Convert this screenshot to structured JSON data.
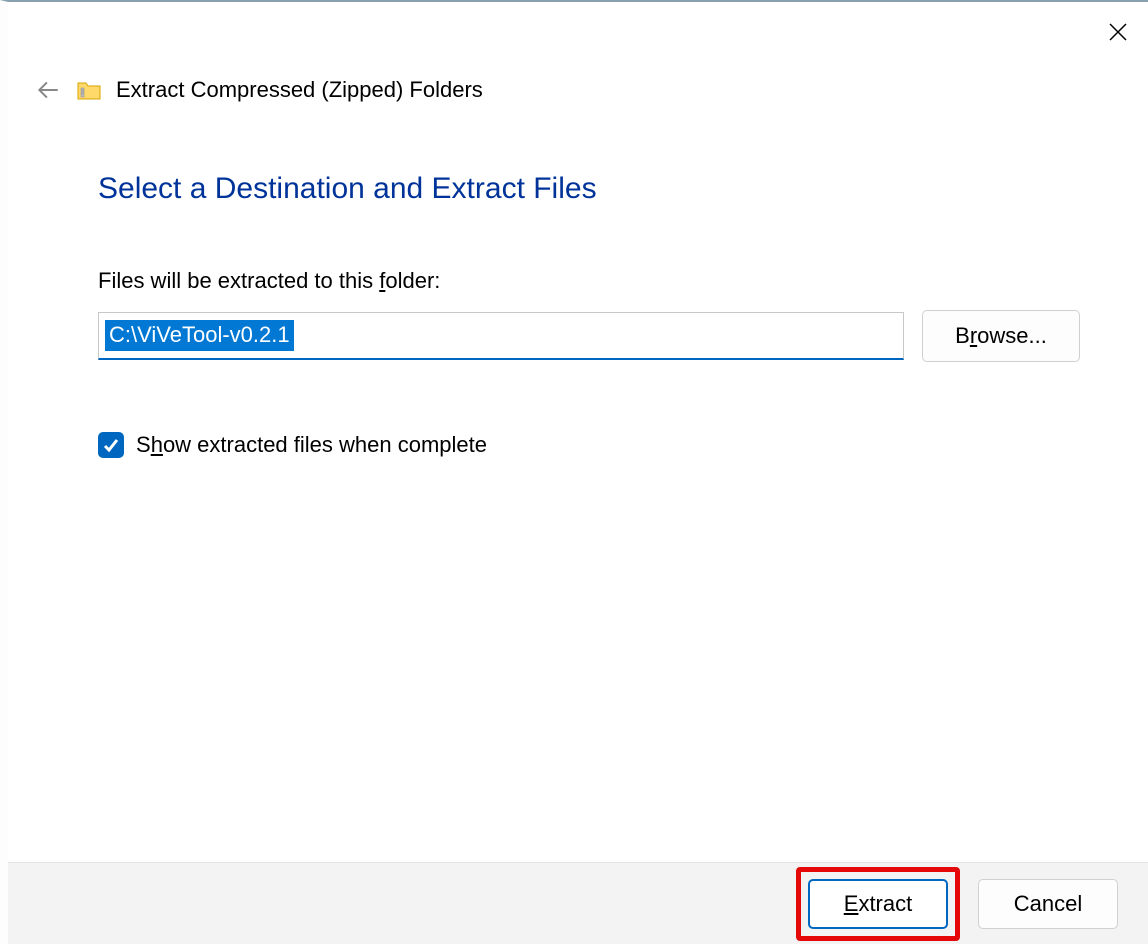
{
  "dialog": {
    "title": "Extract Compressed (Zipped) Folders",
    "heading": "Select a Destination and Extract Files",
    "field_label_pre": "Files will be extracted to this ",
    "field_label_u": "f",
    "field_label_post": "older:",
    "path_value": "C:\\ViVeTool-v0.2.1",
    "browse_pre": "B",
    "browse_u": "r",
    "browse_post": "owse...",
    "checkbox_pre": "S",
    "checkbox_u": "h",
    "checkbox_post": "ow extracted files when complete",
    "checkbox_checked": true,
    "extract_u": "E",
    "extract_post": "xtract",
    "cancel": "Cancel"
  }
}
